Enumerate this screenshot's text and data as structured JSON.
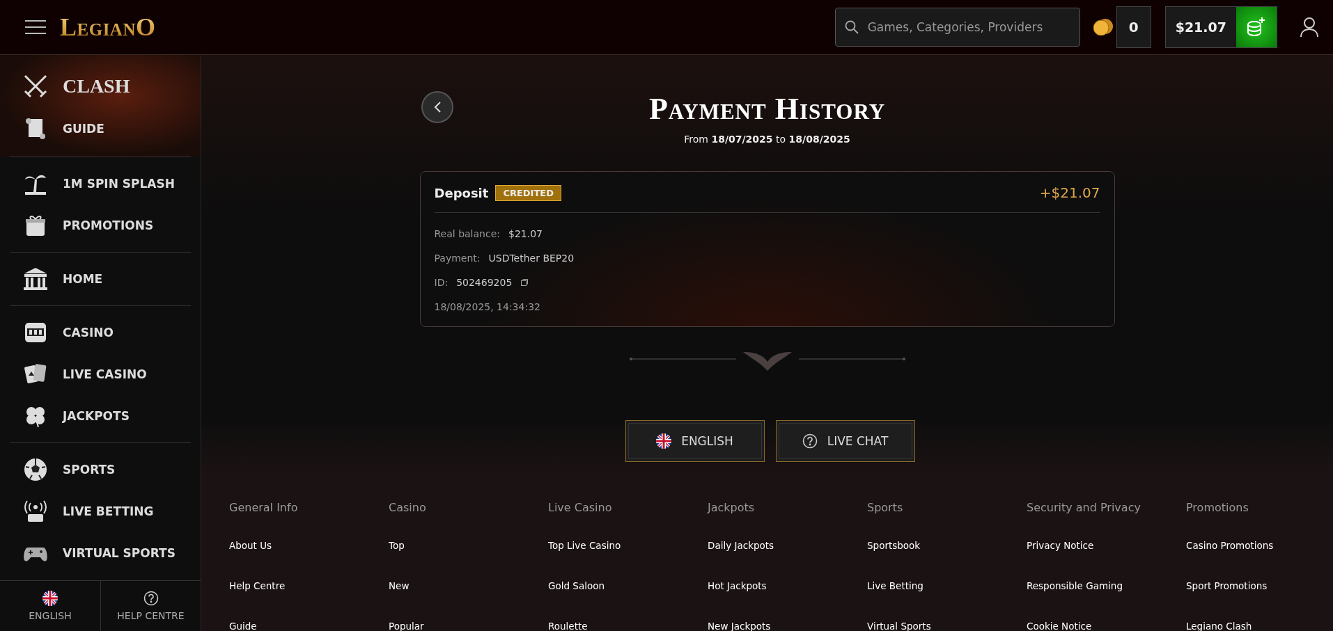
{
  "header": {
    "logo": "LegianO",
    "search": {
      "placeholder": "Games, Categories, Providers"
    },
    "coins": "0",
    "balance": "$21.07"
  },
  "sidebar": {
    "featured": [
      {
        "label": "CLASH",
        "kind": "title"
      },
      {
        "label": "GUIDE",
        "kind": "item"
      }
    ],
    "groups": [
      [
        {
          "label": "1M SPIN SPLASH"
        },
        {
          "label": "PROMOTIONS"
        }
      ],
      [
        {
          "label": "HOME"
        }
      ],
      [
        {
          "label": "CASINO"
        },
        {
          "label": "LIVE CASINO"
        },
        {
          "label": "JACKPOTS"
        }
      ],
      [
        {
          "label": "SPORTS"
        },
        {
          "label": "LIVE BETTING"
        },
        {
          "label": "VIRTUAL SPORTS"
        }
      ]
    ],
    "bottom": [
      {
        "label": "ENGLISH",
        "kind": "language"
      },
      {
        "label": "HELP CENTRE",
        "kind": "help"
      }
    ]
  },
  "page": {
    "title": "Payment History",
    "subtitle": "From **18/07/2025** to **18/08/2025**",
    "transactions": [
      {
        "type": "Deposit",
        "status": "CREDITED",
        "amount": "+$21.07",
        "details": [
          {
            "label": "Real balance:",
            "value": "$21.07"
          },
          {
            "label": "Payment:",
            "value": "USDTether BEP20"
          },
          {
            "label": "ID:",
            "value": "502469205",
            "copyable": true
          }
        ],
        "date": "18/08/2025, 14:34:32"
      }
    ]
  },
  "footer": {
    "buttons": [
      {
        "label": "ENGLISH",
        "kind": "language"
      },
      {
        "label": "LIVE CHAT",
        "kind": "help"
      }
    ],
    "columns": [
      {
        "heading": "General Info",
        "links": [
          "About Us",
          "Help Centre",
          "Guide"
        ]
      },
      {
        "heading": "Casino",
        "links": [
          "Top",
          "New",
          "Popular"
        ]
      },
      {
        "heading": "Live Casino",
        "links": [
          "Top Live Casino",
          "Gold Saloon",
          "Roulette"
        ]
      },
      {
        "heading": "Jackpots",
        "links": [
          "Daily Jackpots",
          "Hot Jackpots",
          "New Jackpots"
        ]
      },
      {
        "heading": "Sports",
        "links": [
          "Sportsbook",
          "Live Betting",
          "Virtual Sports"
        ]
      },
      {
        "heading": "Security and Privacy",
        "links": [
          "Privacy Notice",
          "Responsible Gaming",
          "Cookie Notice"
        ]
      },
      {
        "heading": "Promotions",
        "links": [
          "Casino Promotions",
          "Sport Promotions",
          "Legiano Clash"
        ]
      }
    ]
  }
}
